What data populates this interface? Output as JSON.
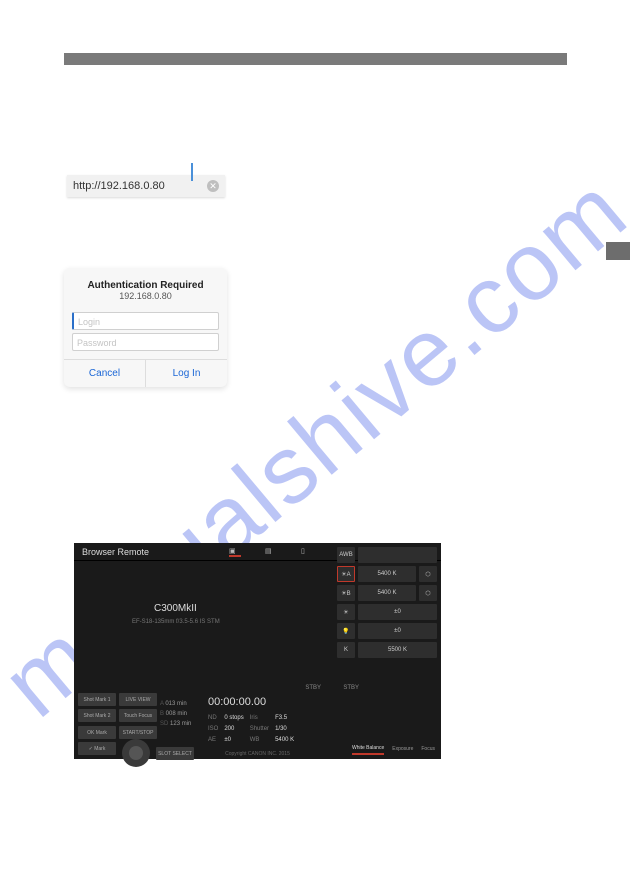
{
  "watermark": "manualshive.com",
  "urlbar": {
    "url": "http://192.168.0.80"
  },
  "auth": {
    "title": "Authentication Required",
    "host": "192.168.0.80",
    "login_ph": "Login",
    "password_ph": "Password",
    "cancel": "Cancel",
    "login_btn": "Log In"
  },
  "remote": {
    "title": "Browser Remote",
    "camera": "C300MkII",
    "lens": "EF-S18-135mm f/3.5-5.6 IS STM",
    "stby": "STBY",
    "stby2": "STBY",
    "tc": "00:00:00.00",
    "media": {
      "a": "013 min",
      "b": "008 min",
      "sd": "123 min"
    },
    "nd_lbl": "ND",
    "nd": "0 stops",
    "iso_lbl": "ISO",
    "iso": "200",
    "ae_lbl": "AE",
    "ae": "±0",
    "iris_lbl": "Iris",
    "iris": "F3.5",
    "shutter_lbl": "Shutter",
    "shutter": "1/30",
    "wb_lbl": "WB",
    "wb": "5400 K",
    "shot1": "Shot Mark 1",
    "shot2": "Shot Mark 2",
    "liveview": "LIVE VIEW",
    "touchfocus": "Touch Focus",
    "okmark": "OK Mark",
    "checkmark": "✓ Mark",
    "startstop": "START/STOP",
    "slot": "SLOT SELECT",
    "wbcol": {
      "awb": "AWB",
      "preset_a": "5400 K",
      "preset_b": "5400 K",
      "star": "±0",
      "star2": "±0",
      "k": "5500 K"
    },
    "foot": {
      "wb": "White Balance",
      "exp": "Exposure",
      "focus": "Focus"
    },
    "copy": "Copyright CANON INC. 2015"
  }
}
